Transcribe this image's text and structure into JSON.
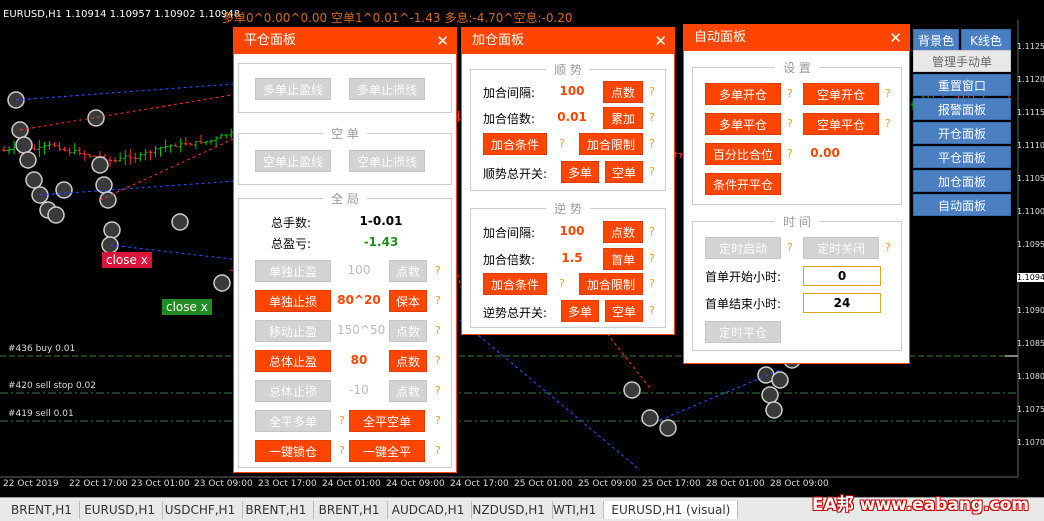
{
  "chart": {
    "symbol_line": "EURUSD,H1  1.10914 1.10957 1.10902 1.10948",
    "stats": "多单0^0.00^0.00  空单1^0.01^-1.43  多息:-4.70^空息:-0.20",
    "price_labels": [
      "1.11250",
      "1.11200",
      "1.11150",
      "1.11100",
      "1.11050",
      "1.11000",
      "1.10950",
      "1.10948",
      "1.10900",
      "1.10850",
      "1.10800",
      "1.10750",
      "1.10700"
    ],
    "time_labels": [
      "22 Oct 2019",
      "22 Oct 17:00",
      "23 Oct 01:00",
      "23 Oct 09:00",
      "23 Oct 17:00",
      "24 Oct 01:00",
      "24 Oct 09:00",
      "24 Oct 17:00",
      "25 Oct 01:00",
      "25 Oct 09:00",
      "25 Oct 17:00",
      "28 Oct 01:00",
      "28 Oct 09:00"
    ],
    "order_lines": [
      "#436 buy 0.01",
      "#420 sell stop 0.02",
      "#419 sell 0.01"
    ],
    "close_tags": [
      "close x",
      "close x"
    ],
    "colors": {
      "up": "#00c800",
      "down": "#ff3030",
      "grid": "#1a1a1a",
      "accent": "#ff4500",
      "button_blue": "#4a7fc1"
    }
  },
  "close_panel": {
    "title": "平仓面板",
    "close_icon": "✕",
    "btn_long_tp": "多单止盈线",
    "btn_long_sl": "多单止损线",
    "grp_short": "空 单",
    "btn_short_tp": "空单止盈线",
    "btn_short_sl": "空单止损线",
    "grp_all": "全 局",
    "lbl_lots": "总手数:",
    "val_lots": "1-0.01",
    "lbl_pnl": "总盈亏:",
    "val_pnl": "-1.43",
    "btn_single_tp": "单独止盈",
    "val_single_tp": "100",
    "btn_single_tp_pts": "点数",
    "btn_single_sl": "单独止损",
    "val_single_sl": "80^20",
    "btn_breakeven": "保本",
    "btn_trail": "移动止盈",
    "val_trail": "150^50",
    "btn_trail_pts": "点数",
    "btn_total_tp": "总体止盈",
    "val_total_tp": "80",
    "btn_total_tp_pts": "点数",
    "btn_total_sl": "总体止损",
    "val_total_sl": "-10",
    "btn_total_sl_pts": "点数",
    "btn_close_all_long": "全平多单",
    "btn_close_all_short": "全平空单",
    "btn_lock": "一键锁仓",
    "btn_close_all": "一键全平",
    "q": "?"
  },
  "add_panel": {
    "title": "加仓面板",
    "close_icon": "✕",
    "grp_trend": "顺 势",
    "lbl_interval": "加合间隔:",
    "val_interval": "100",
    "btn_points": "点数",
    "lbl_multiplier": "加合倍数:",
    "val_multiplier": "0.01",
    "btn_cumulative": "累加",
    "btn_add_cond": "加合条件",
    "btn_add_limit": "加合限制",
    "lbl_trend_switch": "顺势总开关:",
    "btn_long": "多单",
    "btn_short": "空单",
    "grp_counter": "逆 势",
    "lbl_interval2": "加合间隔:",
    "val_interval2": "100",
    "btn_points2": "点数",
    "lbl_multiplier2": "加合倍数:",
    "val_multiplier2": "1.5",
    "btn_first": "首单",
    "btn_add_cond2": "加合条件",
    "btn_add_limit2": "加合限制",
    "lbl_counter_switch": "逆势总开关:",
    "btn_long2": "多单",
    "btn_short2": "空单",
    "q": "?"
  },
  "auto_panel": {
    "title": "自动面板",
    "close_icon": "✕",
    "grp_settings": "设 置",
    "btn_open_long": "多单开仓",
    "btn_open_short": "空单开仓",
    "btn_close_long": "多单平仓",
    "btn_close_short": "空单平仓",
    "btn_pct_close": "百分比合位",
    "val_pct": "0.00",
    "btn_cond_close": "条件开平仓",
    "grp_time": "时 间",
    "btn_timer_start": "定时启动",
    "btn_timer_stop": "定时关闭",
    "lbl_start_hour": "首单开始小时:",
    "val_start_hour": "0",
    "lbl_end_hour": "首单结束小时:",
    "val_end_hour": "24",
    "btn_timer_close": "定时平仓",
    "q": "?"
  },
  "right_menu": {
    "bg_color": "背景色",
    "k_color": "K线色",
    "items": [
      "管理手动单",
      "重置窗口",
      "报警面板",
      "开仓面板",
      "平仓面板",
      "加仓面板",
      "自动面板"
    ]
  },
  "tabs": [
    "BRENT,H1",
    "EURUSD,H1",
    "USDCHF,H1",
    "BRENT,H1",
    "BRENT,H1",
    "AUDCAD,H1",
    "NZDUSD,H1",
    "WTI,H1",
    "EURUSD,H1 (visual)"
  ],
  "watermark": "EA邦 www.eabang.com"
}
